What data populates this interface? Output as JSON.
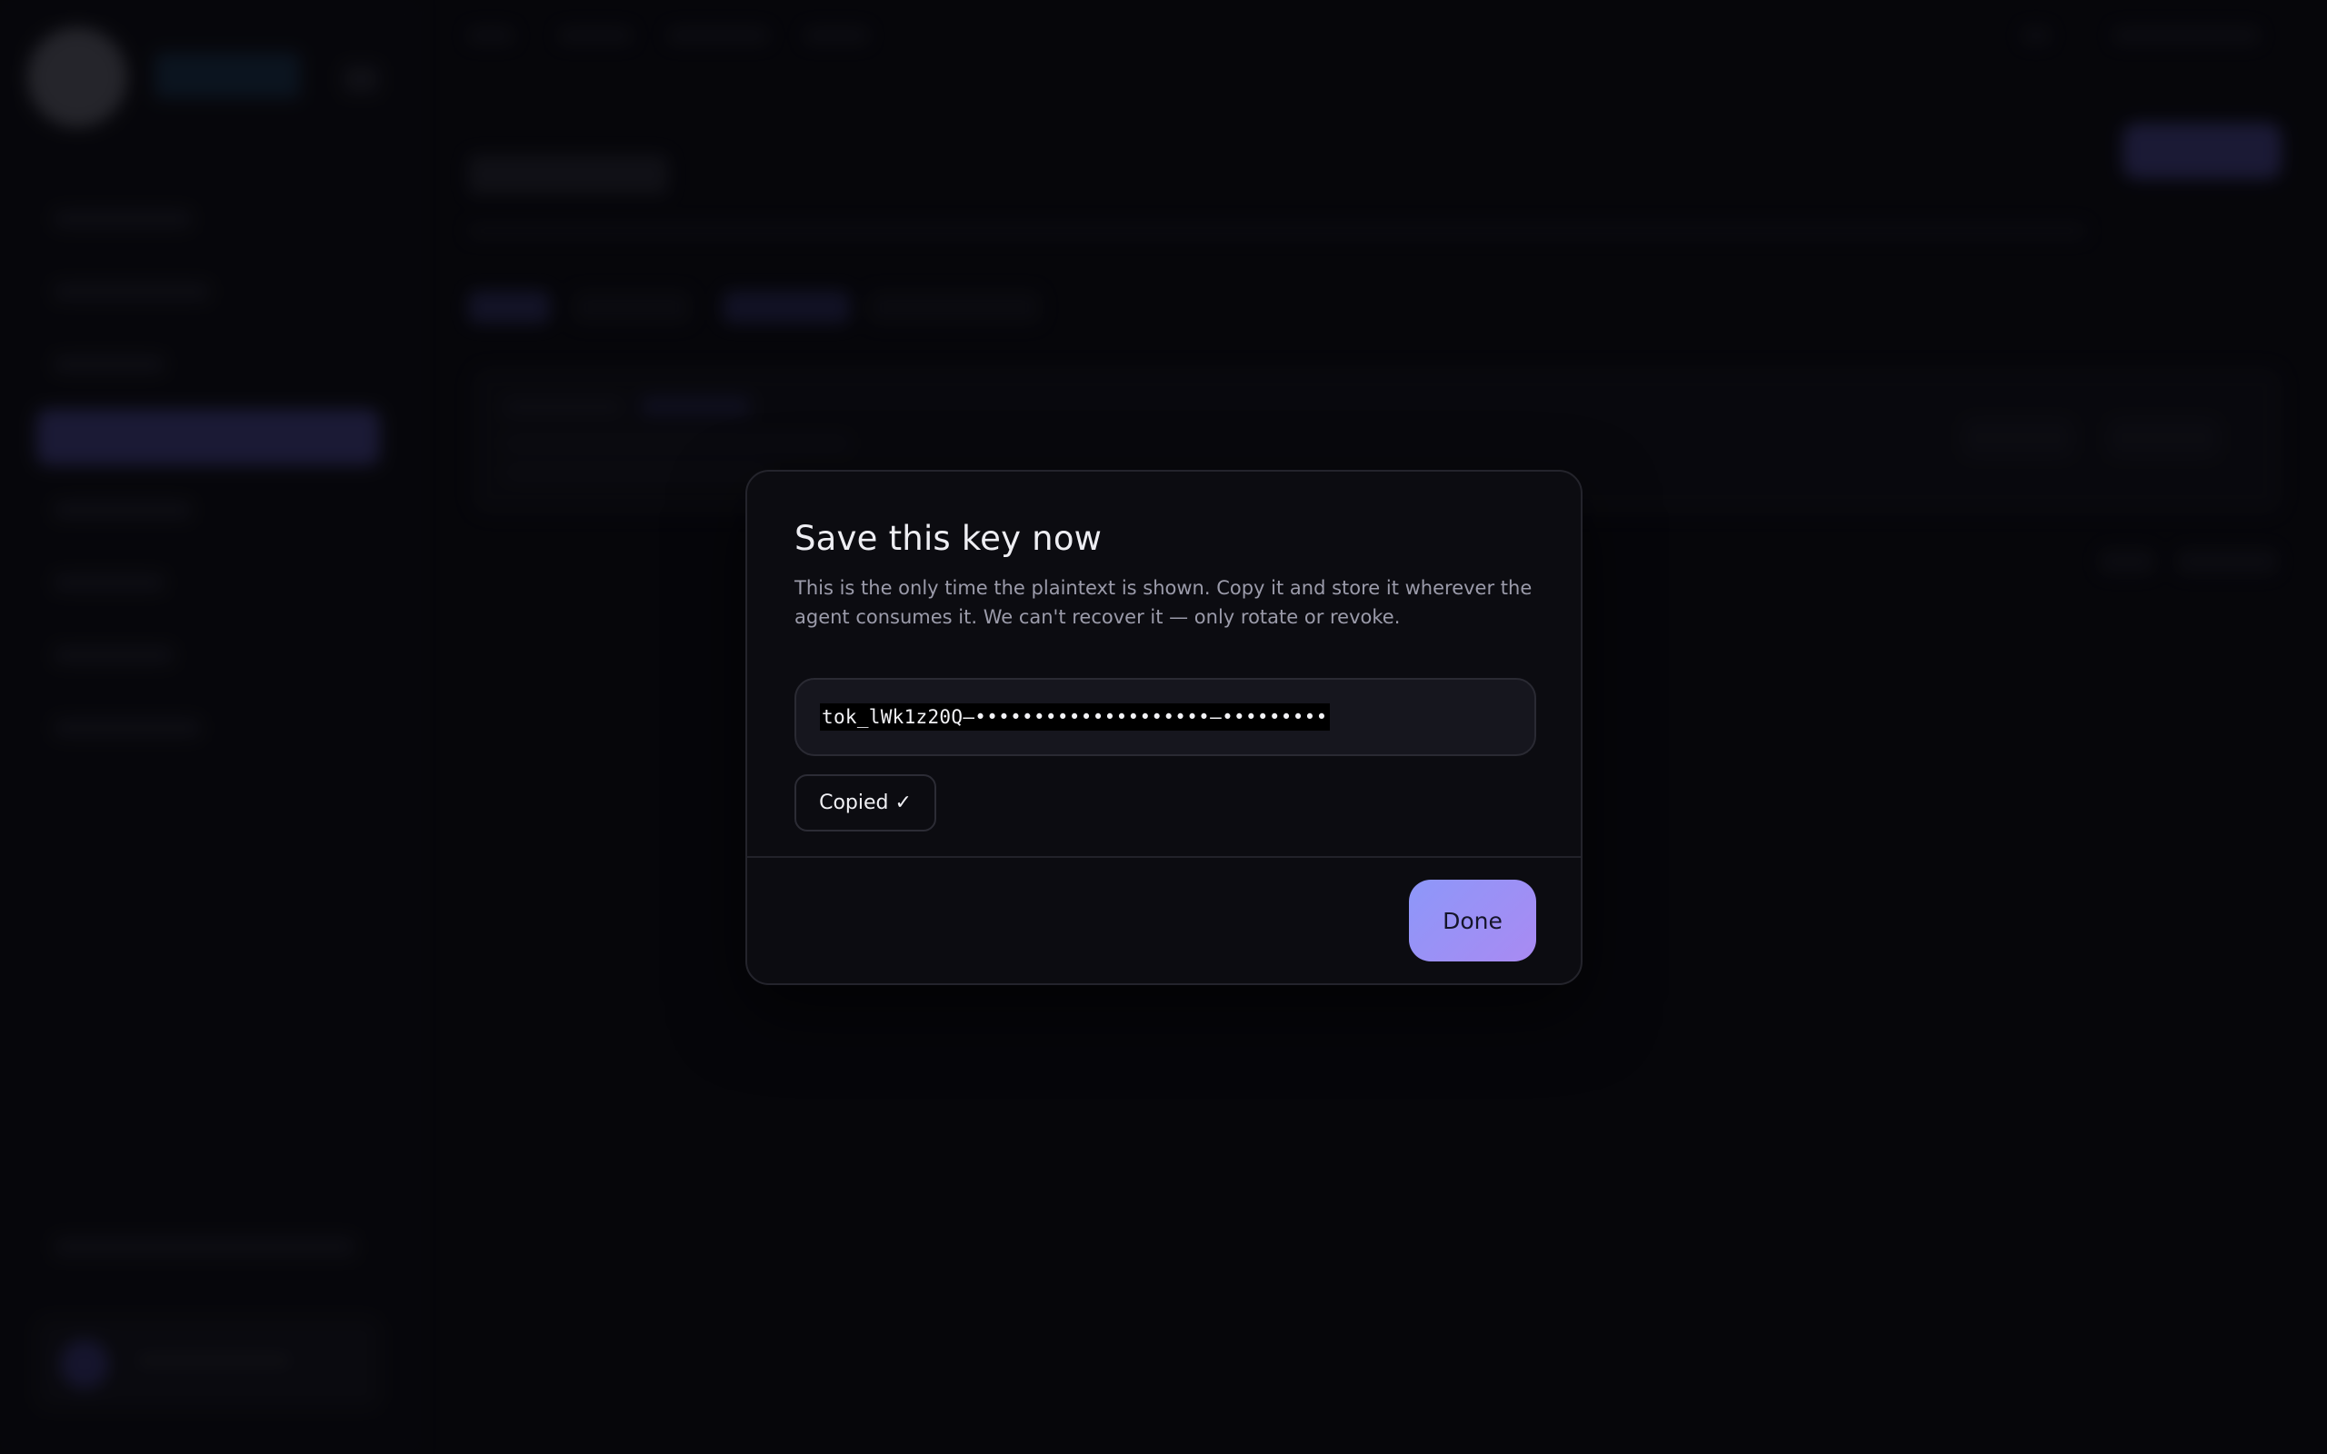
{
  "modal": {
    "title": "Save this key now",
    "description": "This is the only time the plaintext is shown. Copy it and store it wherever the agent consumes it. We can't recover it — only rotate or revoke.",
    "key_value": "tok_lWk1z20Q–••••••••••••••••••••–•••••••••",
    "copy_button_label": "Copied ✓",
    "done_button_label": "Done"
  },
  "colors": {
    "accent_gradient_start": "#8d97f9",
    "accent_gradient_end": "#a98af2",
    "modal_background": "#0c0c11",
    "page_background": "#08080c"
  }
}
